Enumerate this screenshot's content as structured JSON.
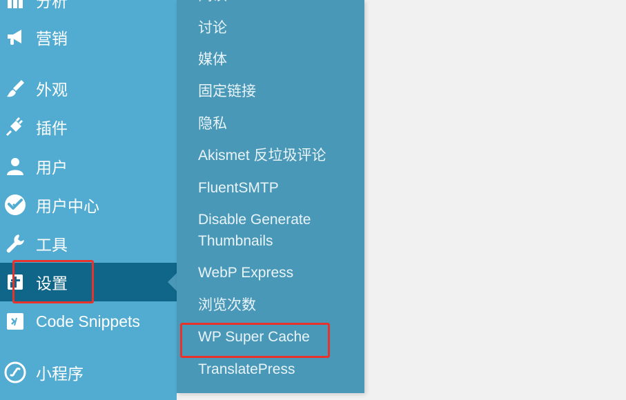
{
  "sidebar": {
    "items": [
      {
        "label": "分析",
        "icon": "bar-chart-icon"
      },
      {
        "label": "营销",
        "icon": "megaphone-icon"
      },
      {
        "label": "外观",
        "icon": "paintbrush-icon"
      },
      {
        "label": "插件",
        "icon": "plugin-icon"
      },
      {
        "label": "用户",
        "icon": "user-icon"
      },
      {
        "label": "用户中心",
        "icon": "user-center-icon"
      },
      {
        "label": "工具",
        "icon": "wrench-icon"
      },
      {
        "label": "设置",
        "icon": "settings-icon",
        "active": true
      },
      {
        "label": "Code Snippets",
        "icon": "code-icon"
      },
      {
        "label": "小程序",
        "icon": "link-icon"
      }
    ]
  },
  "submenu": {
    "items": [
      {
        "label": "阅读"
      },
      {
        "label": "讨论"
      },
      {
        "label": "媒体"
      },
      {
        "label": "固定链接"
      },
      {
        "label": "隐私"
      },
      {
        "label": "Akismet 反垃圾评论"
      },
      {
        "label": "FluentSMTP"
      },
      {
        "label": "Disable Generate Thumbnails"
      },
      {
        "label": "WebP Express"
      },
      {
        "label": "浏览次数"
      },
      {
        "label": "WP Super Cache"
      },
      {
        "label": "TranslatePress"
      }
    ]
  },
  "colors": {
    "sidebar_bg": "#52acd1",
    "active_bg": "#0f6688",
    "submenu_bg": "#4a98b8",
    "highlight": "#e8322b"
  }
}
